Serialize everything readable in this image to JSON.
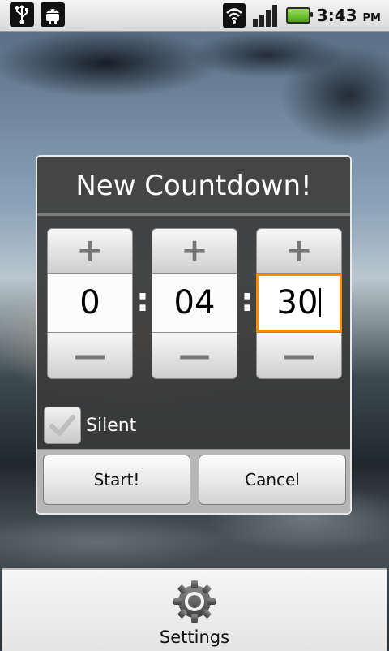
{
  "statusbar": {
    "left_icons": [
      "usb-icon",
      "android-debug-icon"
    ],
    "time": "3:43",
    "ampm": "PM",
    "icons": [
      "wifi-icon",
      "signal-icon",
      "battery-icon"
    ]
  },
  "dialog": {
    "title": "New Countdown!",
    "pickers": {
      "hours": {
        "increment": "+",
        "value": "0",
        "decrement": "—"
      },
      "minutes": {
        "increment": "+",
        "value": "04",
        "decrement": "—"
      },
      "seconds": {
        "increment": "+",
        "value": "30",
        "decrement": "—"
      }
    },
    "separator": ":",
    "silent": {
      "label": "Silent",
      "checked": true
    },
    "start_label": "Start!",
    "cancel_label": "Cancel"
  },
  "menu": {
    "items": [
      {
        "label": "Settings",
        "icon": "settings-gear-icon"
      }
    ]
  },
  "colors": {
    "focus": "#ff8c00",
    "battery": "#6bc324"
  }
}
